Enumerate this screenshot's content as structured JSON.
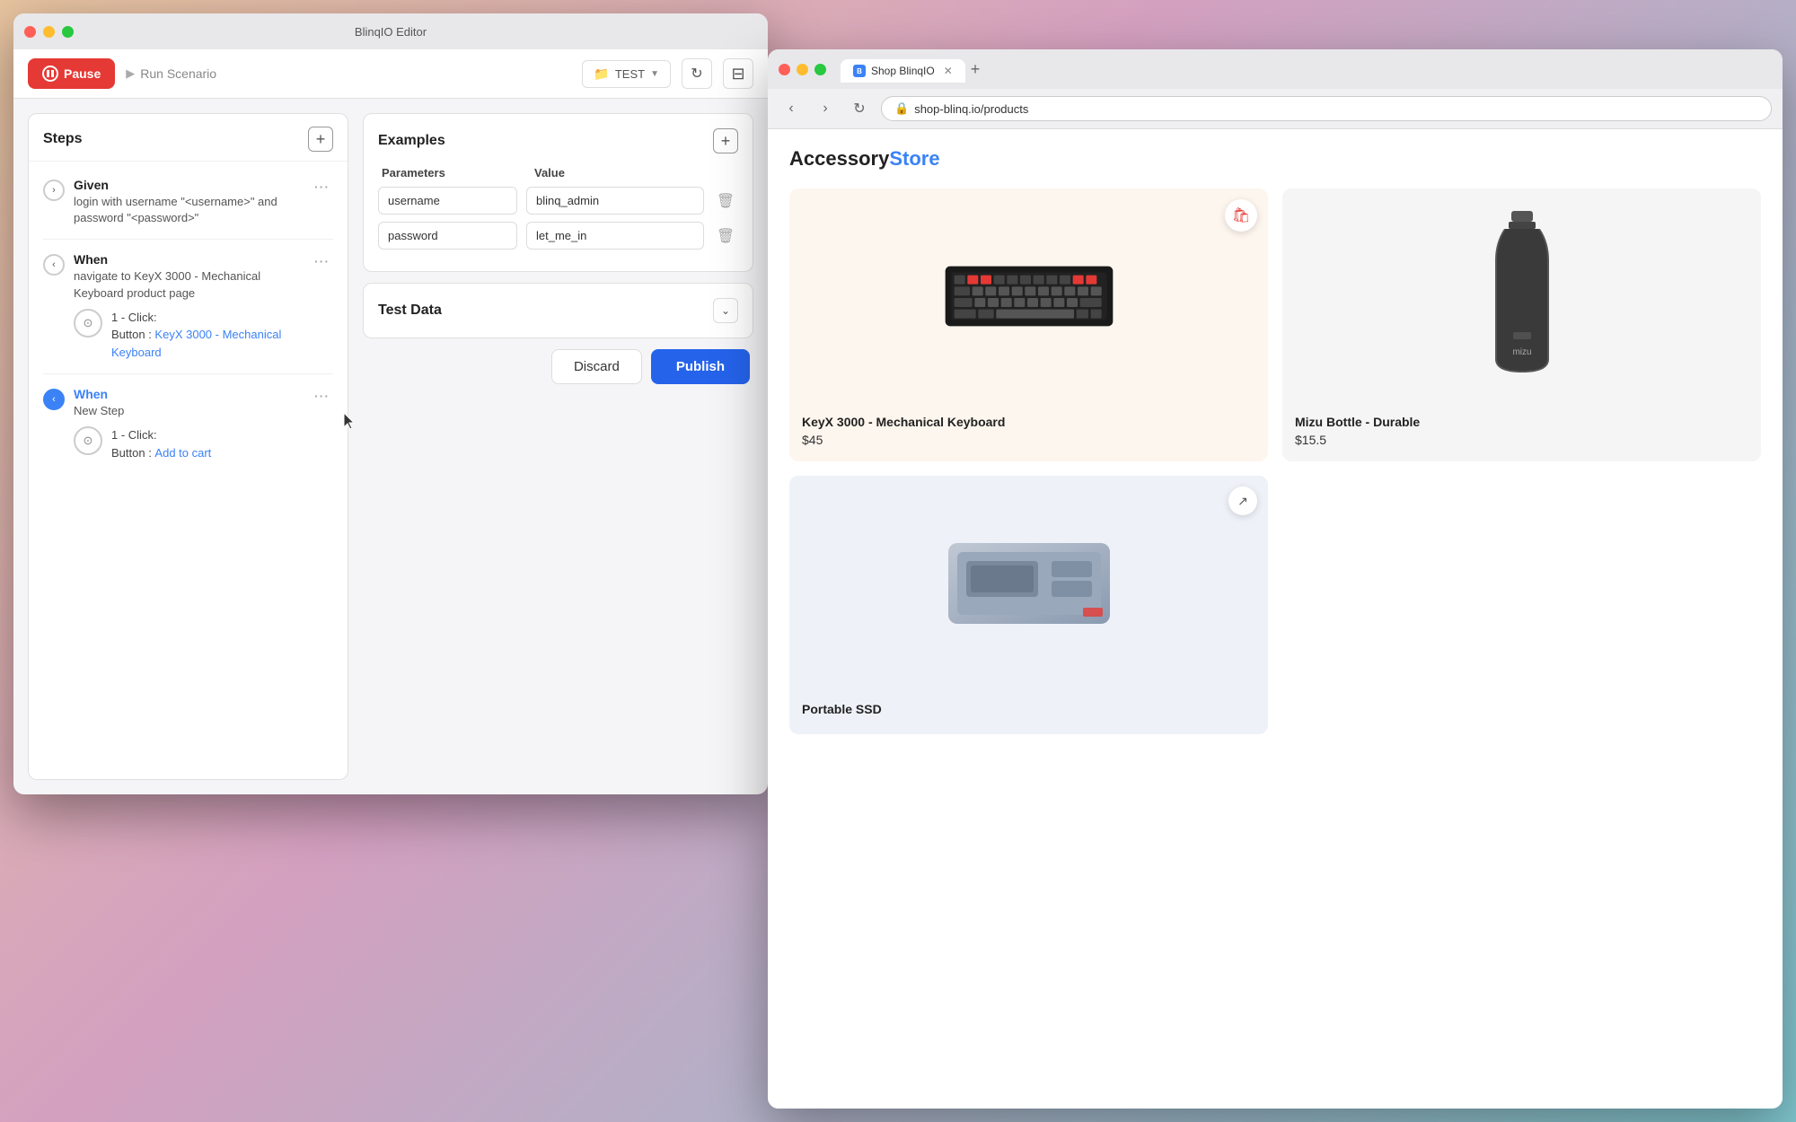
{
  "editor": {
    "title": "BlinqIO Editor",
    "toolbar": {
      "pause_label": "Pause",
      "run_label": "Run Scenario",
      "folder_label": "TEST",
      "refresh_icon": "↻",
      "panel_icon": "⊞"
    },
    "steps_panel": {
      "title": "Steps",
      "add_icon": "+",
      "steps": [
        {
          "id": "step-1",
          "type": "Given",
          "description": "login with username \"<username>\" and password \"<password>\"",
          "expanded": false,
          "chevron": "›"
        },
        {
          "id": "step-2",
          "type": "When",
          "description": "navigate to KeyX 3000 - Mechanical Keyboard product page",
          "expanded": true,
          "chevron": "‹",
          "detail": {
            "number": "1 - Click:",
            "label": "Button :",
            "link_text": "KeyX 3000 - Mechanical Keyboard"
          }
        },
        {
          "id": "step-3",
          "type": "When",
          "description": "New Step",
          "expanded": true,
          "chevron": "‹",
          "active": true,
          "detail": {
            "number": "1 - Click:",
            "label": "Button :",
            "link_text": "Add to cart"
          }
        }
      ]
    },
    "examples_panel": {
      "title": "Examples",
      "add_icon": "+",
      "col_params": "Parameters",
      "col_value": "Value",
      "rows": [
        {
          "param": "username",
          "value": "blinq_admin"
        },
        {
          "param": "password",
          "value": "let_me_in"
        }
      ]
    },
    "test_data_panel": {
      "title": "Test Data",
      "chevron": "⌄"
    },
    "bottom_actions": {
      "discard_label": "Discard",
      "publish_label": "Publish"
    }
  },
  "browser": {
    "tab_title": "Shop BlinqIO",
    "new_tab_icon": "+",
    "nav": {
      "back_icon": "‹",
      "forward_icon": "›",
      "refresh_icon": "↻",
      "url": "shop-blinq.io/products",
      "security_icon": "🔒"
    },
    "shop": {
      "logo_part1": "Accessory",
      "logo_part2": "Store",
      "products": [
        {
          "id": "product-keyboard",
          "name": "KeyX 3000 - Mechanical Keyboard",
          "price": "$45",
          "bg": "#fdf6ee",
          "has_wishlist": true
        },
        {
          "id": "product-bottle",
          "name": "Mizu Bottle - Durable",
          "price": "$15.5",
          "bg": "#f5f5f5",
          "has_wishlist": false
        },
        {
          "id": "product-ssd",
          "name": "Portable SSD",
          "price": "",
          "bg": "#eef2f8",
          "has_wishlist": false,
          "has_share": true
        }
      ]
    }
  }
}
